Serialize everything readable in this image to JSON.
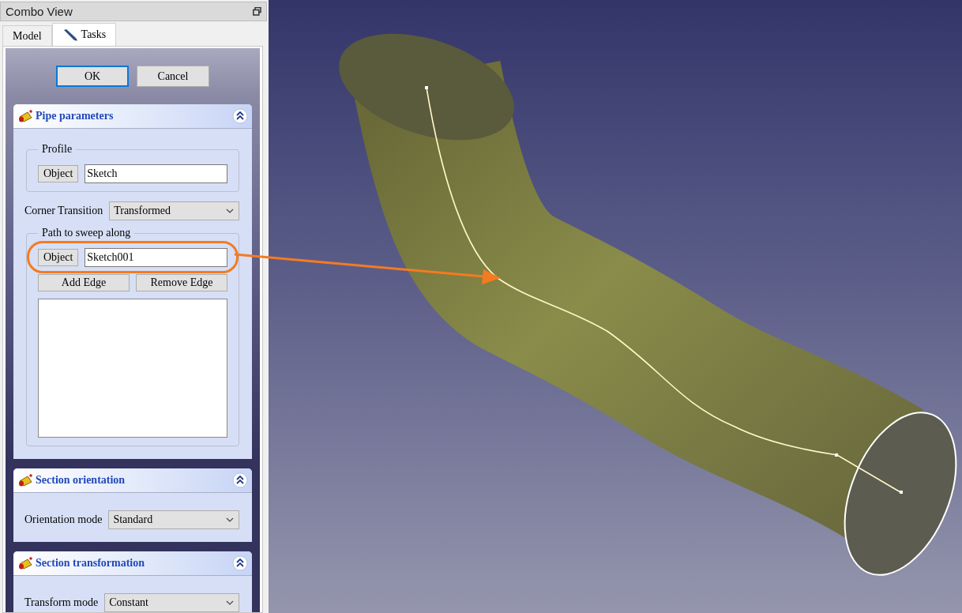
{
  "dock": {
    "title": "Combo View"
  },
  "tabs": [
    {
      "label": "Model",
      "selected": false
    },
    {
      "label": "Tasks",
      "selected": true
    }
  ],
  "buttons": [
    {
      "label": "OK",
      "default": true
    },
    {
      "label": "Cancel",
      "default": false
    }
  ],
  "panels": [
    {
      "title": "Pipe parameters",
      "expanded": true,
      "rows": [
        {
          "kind": "group",
          "title": "Profile",
          "object_button": "Object",
          "value": "Sketch"
        },
        {
          "kind": "combo",
          "label": "Corner Transition",
          "value": "Transformed"
        },
        {
          "kind": "group",
          "title": "Path to sweep along",
          "object_button": "Object",
          "value": "Sketch001",
          "edge_buttons": [
            "Add Edge",
            "Remove Edge"
          ]
        }
      ]
    },
    {
      "title": "Section orientation",
      "expanded": true,
      "rows": [
        {
          "kind": "combo",
          "label": "Orientation mode",
          "value": "Standard"
        }
      ]
    },
    {
      "title": "Section transformation",
      "expanded": true,
      "rows": [
        {
          "kind": "combo",
          "label": "Transform mode",
          "value": "Constant"
        }
      ]
    }
  ]
}
